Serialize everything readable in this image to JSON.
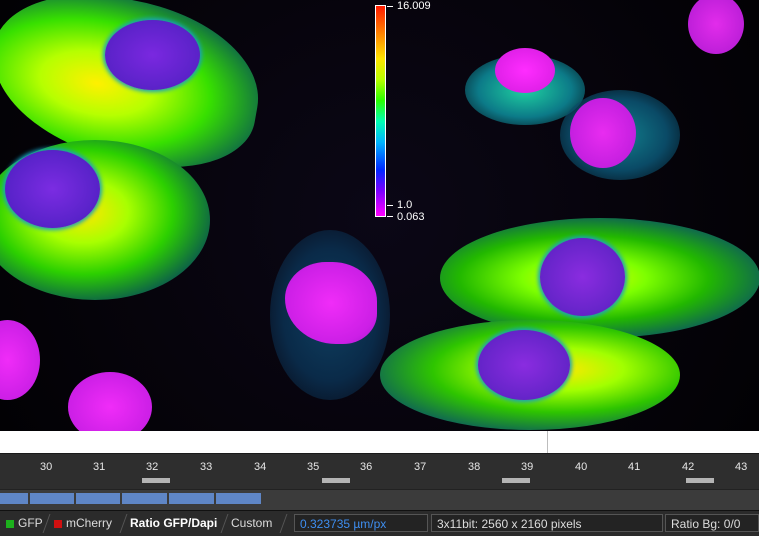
{
  "colorbar": {
    "max_label": "16.009",
    "one_label": "1.0",
    "min_label": "0.063",
    "colors": [
      "#ff1a00",
      "#ffe400",
      "#2aff00",
      "#00b4ff",
      "#0028ff",
      "#ff00ff"
    ]
  },
  "timeline": {
    "ticks": [
      "30",
      "31",
      "32",
      "33",
      "34",
      "35",
      "36",
      "37",
      "38",
      "39",
      "40",
      "41",
      "42",
      "43"
    ]
  },
  "progress": {
    "segments": 6
  },
  "tabs": [
    {
      "label": "GFP",
      "swatch": "#1cb01c"
    },
    {
      "label": "mCherry",
      "swatch": "#d01010"
    },
    {
      "label": "Ratio GFP/Dapi",
      "active": true
    },
    {
      "label": "Custom"
    }
  ],
  "status": {
    "pixel_size": "0.323735 µm/px",
    "image_info": "3x11bit: 2560 x 2160 pixels",
    "ratio_bg": "Ratio Bg: 0/0"
  }
}
